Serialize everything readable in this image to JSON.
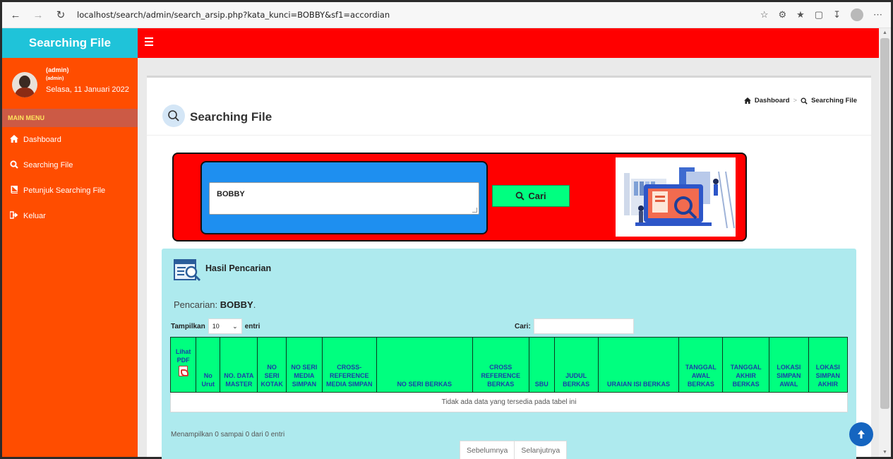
{
  "browser": {
    "url": "localhost/search/admin/search_arsip.php?kata_kunci=BOBBY&sf1=accordian"
  },
  "sidebar": {
    "brand": "Searching File",
    "user": {
      "name": "(admin)",
      "role": "(admin)",
      "date": "Selasa, 11 Januari 2022"
    },
    "section_label": "MAIN MENU",
    "items": [
      {
        "icon": "home-icon",
        "label": "Dashboard"
      },
      {
        "icon": "search-icon",
        "label": "Searching File"
      },
      {
        "icon": "book-icon",
        "label": "Petunjuk Searching File"
      },
      {
        "icon": "sign-out-icon",
        "label": "Keluar"
      }
    ]
  },
  "page": {
    "title": "Searching File",
    "breadcrumb": [
      "Dashboard",
      "Searching File"
    ]
  },
  "search": {
    "value": "BOBBY",
    "button_label": "Cari"
  },
  "results": {
    "title": "Hasil Pencarian",
    "query_prefix": "Pencarian: ",
    "query": "BOBBY",
    "query_suffix": ".",
    "length_label_pre": "Tampilkan",
    "length_value": "10",
    "length_label_post": "entri",
    "filter_label": "Cari:",
    "columns": [
      "Lihat PDF",
      "No Urut",
      "NO. DATA MASTER",
      "NO SERI KOTAK",
      "NO SERI MEDIA SIMPAN",
      "CROSS-REFERENCE MEDIA SIMPAN",
      "NO SERI BERKAS",
      "CROSS REFERENCE BERKAS",
      "SBU",
      "JUDUL BERKAS",
      "URAIAN ISI BERKAS",
      "TANGGAL AWAL BERKAS",
      "TANGGAL AKHIR BERKAS",
      "LOKASI SIMPAN AWAL",
      "LOKASI SIMPAN AKHIR"
    ],
    "empty_message": "Tidak ada data yang tersedia pada tabel ini",
    "info": "Menampilkan 0 sampai 0 dari 0 entri",
    "prev_label": "Sebelumnya",
    "next_label": "Selanjutnya"
  },
  "colors": {
    "brand_bg": "#1fc3d9",
    "sidebar_bg": "#ff4d00",
    "topbar_bg": "#ff0000",
    "table_header_bg": "#00ff7f",
    "results_bg": "#aeeaee",
    "search_inner_bg": "#1e8ff0"
  }
}
